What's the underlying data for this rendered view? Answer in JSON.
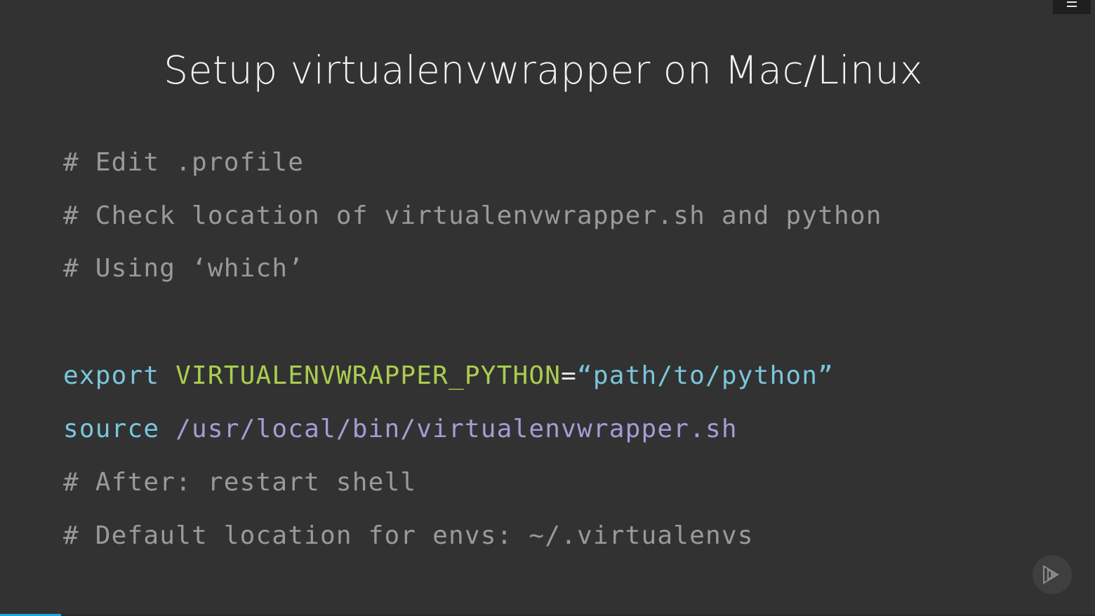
{
  "slide": {
    "title": "Setup virtualenvwrapper on Mac/Linux",
    "lines": {
      "l1": {
        "text": "# Edit .profile"
      },
      "l2": {
        "text": "# Check location of virtualenvwrapper.sh and python"
      },
      "l3": {
        "text": "# Using ‘which’"
      },
      "l4": {
        "keyword": "export",
        "variable": "VIRTUALENVWRAPPER_PYTHON",
        "equals": "=",
        "value": "“path/to/python”"
      },
      "l5": {
        "keyword": "source",
        "path": "/usr/local/bin/virtualenvwrapper.sh"
      },
      "l6": {
        "text": "# After: restart shell"
      },
      "l7": {
        "text": "# Default location for envs: ~/.virtualenvs"
      }
    }
  },
  "controls": {
    "menu_icon": "hamburger-menu-icon",
    "play_icon": "pluralsight-play-icon"
  },
  "progress": {
    "fraction": 0.056
  },
  "colors": {
    "background": "#323232",
    "title": "#f2f2f2",
    "comment": "#9a9a9a",
    "keyword": "#79c6dd",
    "variable": "#a9cd4f",
    "path": "#a99ad6",
    "progress": "#1aa6e8"
  }
}
